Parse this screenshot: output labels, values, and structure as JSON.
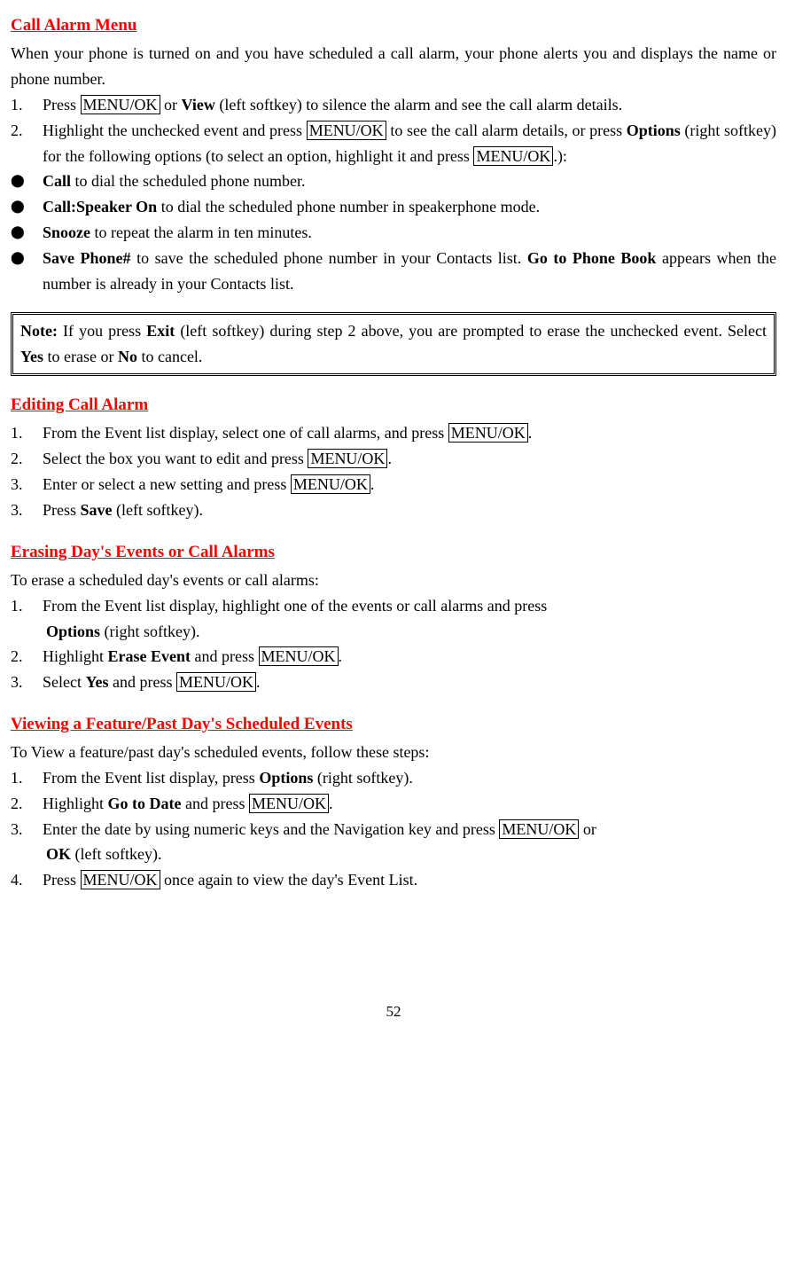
{
  "section1": {
    "heading": "Call Alarm Menu",
    "intro": "When your phone is turned on and you have scheduled a call alarm, your phone alerts you and displays the name or phone number.",
    "step1_a": "Press ",
    "step1_key1": "MENU/OK",
    "step1_b": " or ",
    "step1_bold1": "View",
    "step1_c": " (left softkey) to silence the alarm and see the call alarm details.",
    "step2_a": "Highlight the unchecked event and press ",
    "step2_key1": "MENU/OK",
    "step2_b": " to see the call alarm details, or press ",
    "step2_bold1": "Options",
    "step2_c": " (right softkey) for the following options (to select an option, highlight it and press ",
    "step2_key2": "MENU/OK",
    "step2_d": ".):",
    "bullet1_bold": "Call",
    "bullet1_rest": " to dial the scheduled phone number.",
    "bullet2_bold": "Call:Speaker On",
    "bullet2_rest": " to dial the scheduled phone number in speakerphone mode.",
    "bullet3_bold": "Snooze",
    "bullet3_rest": " to repeat the alarm in ten minutes.",
    "bullet4_bold": "Save Phone#",
    "bullet4_mid": " to save the scheduled phone number in your Contacts list. ",
    "bullet4_bold2": "Go to Phone Book",
    "bullet4_rest": " appears when the number is already in your Contacts list.",
    "note_bold1": "Note:",
    "note_a": " If you press ",
    "note_bold2": "Exit",
    "note_b": " (left softkey) during step 2 above, you are prompted to erase the unchecked event. Select ",
    "note_bold3": "Yes",
    "note_c": " to erase or ",
    "note_bold4": "No",
    "note_d": " to cancel."
  },
  "section2": {
    "heading": "Editing Call Alarm",
    "step1_a": "From the Event list display, select one of call alarms, and press ",
    "step1_key": "MENU/OK",
    "step1_b": ".",
    "step2_a": "Select the box you want to edit and press ",
    "step2_key": "MENU/OK",
    "step2_b": ".",
    "step3_a": "Enter or select a new setting and press ",
    "step3_key": "MENU/OK",
    "step3_b": ".",
    "step4_a": "Press ",
    "step4_bold": "Save",
    "step4_b": " (left softkey)."
  },
  "section3": {
    "heading": "Erasing Day's Events or Call Alarms",
    "intro": "To erase a scheduled day's events or call alarms:",
    "step1_a": "From the Event list display, highlight one of the events or call alarms and press",
    "step1_bold": "Options",
    "step1_b": " (right softkey).",
    "step2_a": "Highlight ",
    "step2_bold": "Erase Event",
    "step2_b": " and press ",
    "step2_key": "MENU/OK",
    "step2_c": ".",
    "step3_a": "Select ",
    "step3_bold": "Yes",
    "step3_b": " and press ",
    "step3_key": "MENU/OK",
    "step3_c": "."
  },
  "section4": {
    "heading": "Viewing a Feature/Past Day's Scheduled Events",
    "intro": "To View a feature/past day's scheduled events, follow these steps:",
    "step1_a": "From the Event list display, press ",
    "step1_bold": "Options",
    "step1_b": " (right softkey).",
    "step2_a": "Highlight ",
    "step2_bold": "Go to Date",
    "step2_b": " and press ",
    "step2_key": "MENU/OK",
    "step2_c": ".",
    "step3_a": "Enter the date by using numeric keys and the Navigation key and press ",
    "step3_key": "MENU/OK",
    "step3_b": " or",
    "step3_bold": "OK",
    "step3_c": " (left softkey).",
    "step4_a": "Press ",
    "step4_key": "MENU/OK",
    "step4_b": " once again to view the day's Event List."
  },
  "pageNumber": "52"
}
